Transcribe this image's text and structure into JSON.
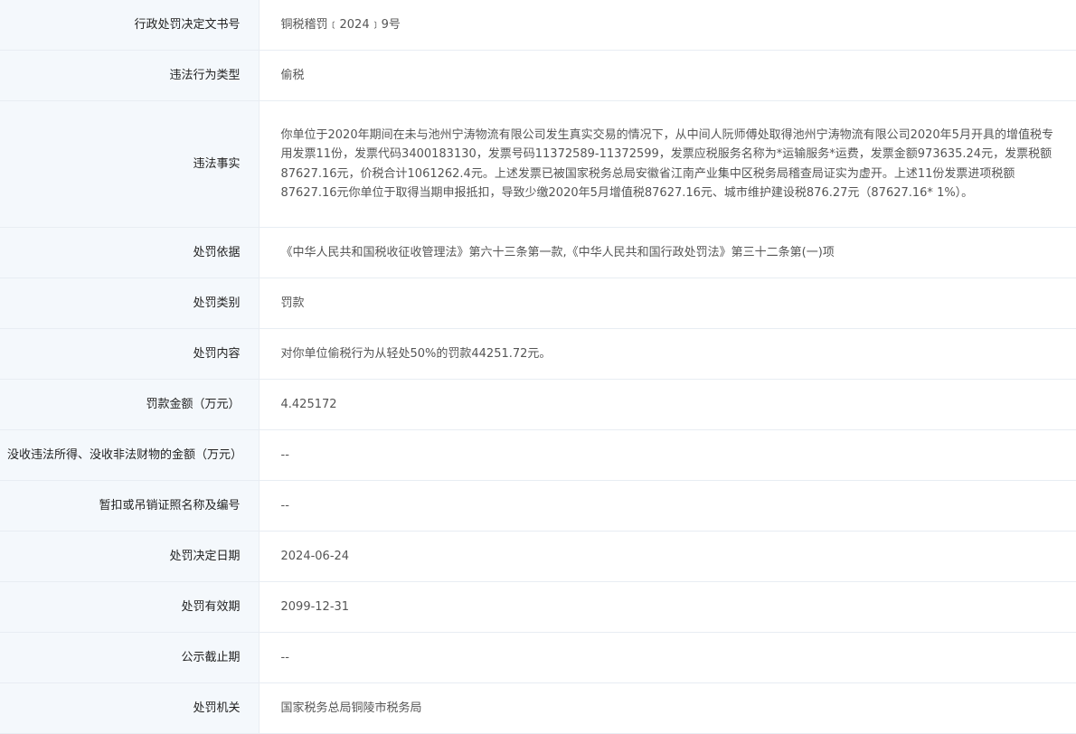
{
  "rows": [
    {
      "label": "行政处罚决定文书号",
      "value": "铜税稽罚﹝2024﹞9号"
    },
    {
      "label": "违法行为类型",
      "value": "偷税"
    },
    {
      "label": "违法事实",
      "value": "你单位于2020年期间在未与池州宁涛物流有限公司发生真实交易的情况下，从中间人阮师傅处取得池州宁涛物流有限公司2020年5月开具的增值税专用发票11份，发票代码3400183130，发票号码11372589-11372599，发票应税服务名称为*运输服务*运费，发票金额973635.24元，发票税额87627.16元，价税合计1061262.4元。上述发票已被国家税务总局安徽省江南产业集中区税务局稽查局证实为虚开。上述11份发票进项税额87627.16元你单位于取得当期申报抵扣，导致少缴2020年5月增值税87627.16元、城市维护建设税876.27元（87627.16* 1%）。"
    },
    {
      "label": "处罚依据",
      "value": "《中华人民共和国税收征收管理法》第六十三条第一款,《中华人民共和国行政处罚法》第三十二条第(一)项"
    },
    {
      "label": "处罚类别",
      "value": "罚款"
    },
    {
      "label": "处罚内容",
      "value": "对你单位偷税行为从轻处50%的罚款44251.72元。"
    },
    {
      "label": "罚款金额（万元）",
      "value": "4.425172"
    },
    {
      "label": "没收违法所得、没收非法财物的金额（万元）",
      "value": "--"
    },
    {
      "label": "暂扣或吊销证照名称及编号",
      "value": "--"
    },
    {
      "label": "处罚决定日期",
      "value": "2024-06-24"
    },
    {
      "label": "处罚有效期",
      "value": "2099-12-31"
    },
    {
      "label": "公示截止期",
      "value": "--"
    },
    {
      "label": "处罚机关",
      "value": "国家税务总局铜陵市税务局"
    }
  ]
}
